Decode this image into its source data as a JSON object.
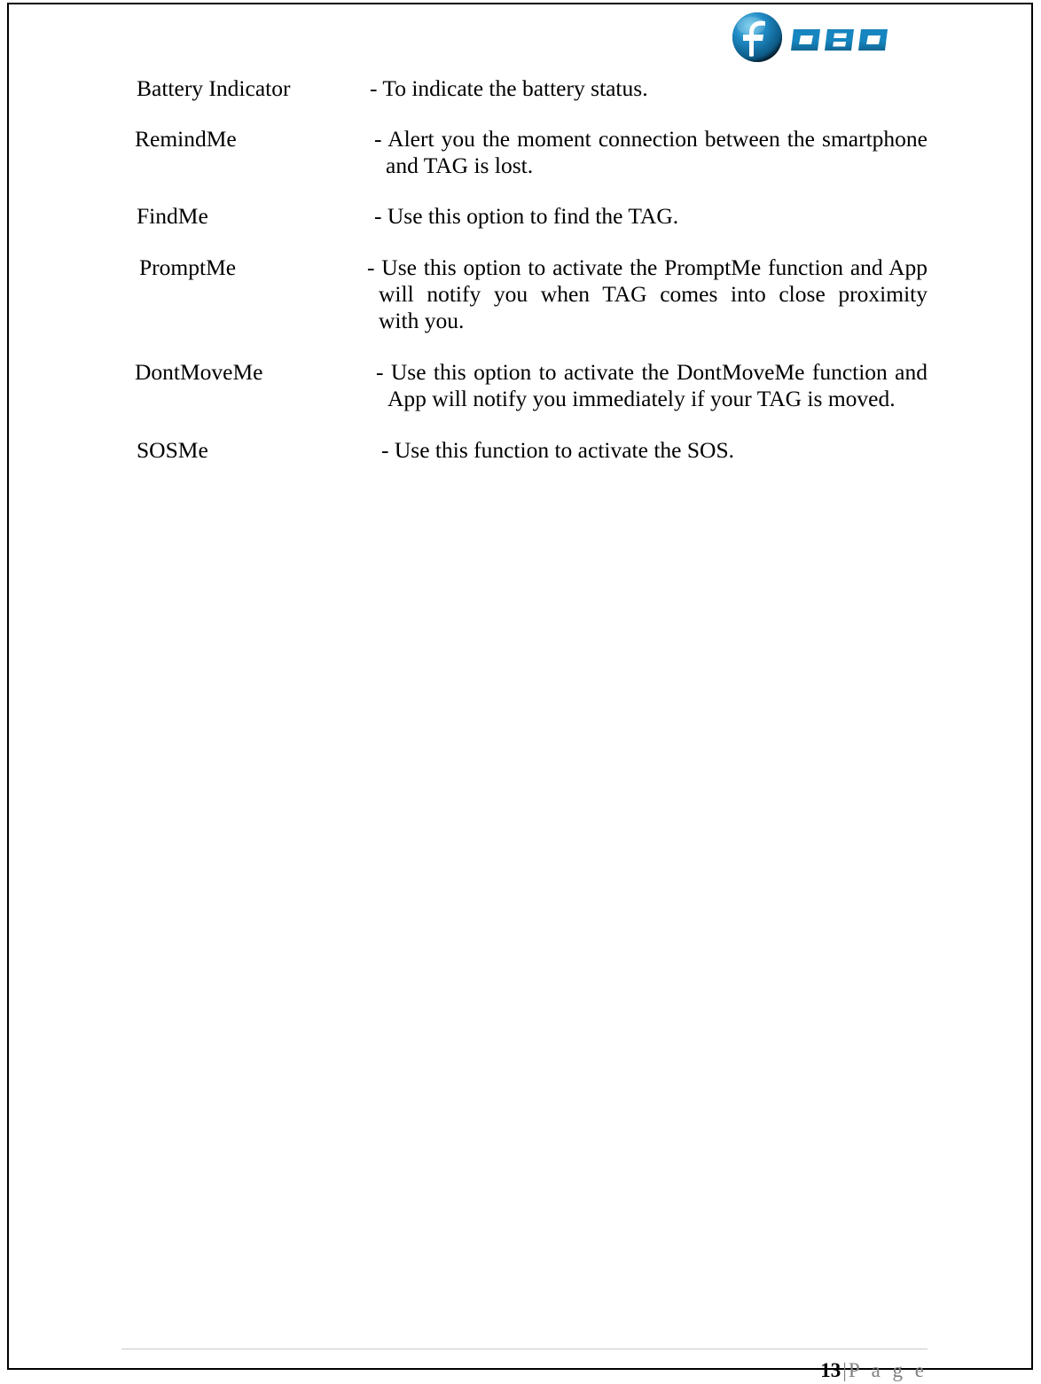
{
  "document": {
    "header": {
      "logo_name": "fobo-logo",
      "logo_text": "OBO",
      "logo_mark_letter": "f",
      "logo_color": "#1583bd",
      "logo_dark_color": "#0e5c87",
      "logo_light_color": "#4fb8e0"
    },
    "entries": [
      {
        "label": "Battery Indicator",
        "lines": [
          "- To indicate the battery status."
        ]
      },
      {
        "label": "RemindMe",
        "lines": [
          "- Alert you the moment connection between the smartphone",
          "and TAG is lost."
        ]
      },
      {
        "label": "FindMe",
        "lines": [
          "- Use this option to find the TAG."
        ]
      },
      {
        "label": "PromptMe",
        "lines": [
          "- Use this option to activate the PromptMe function and App",
          "will notify you when TAG comes into close proximity",
          "with you."
        ]
      },
      {
        "label": "DontMoveMe",
        "lines": [
          "- Use this option to activate the DontMoveMe function and",
          "App will notify you immediately if your TAG is moved."
        ]
      },
      {
        "label": "SOSMe",
        "lines": [
          "- Use this function to activate the SOS."
        ]
      }
    ],
    "footer": {
      "page_number": "13",
      "separator": "|",
      "page_word": "P a g e"
    }
  }
}
